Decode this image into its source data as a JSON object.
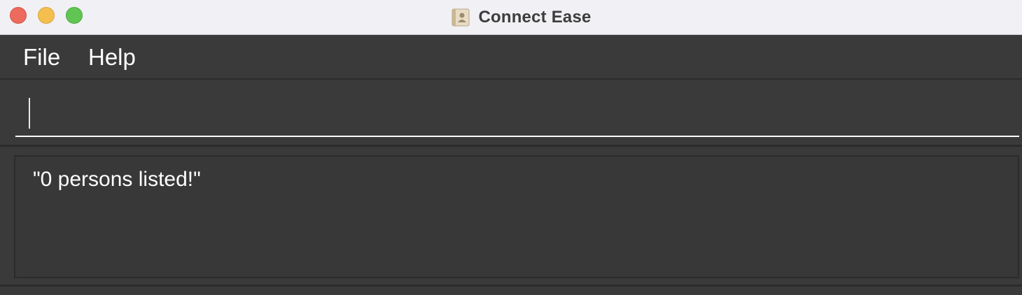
{
  "window": {
    "title": "Connect Ease",
    "controls": [
      "close",
      "minimize",
      "zoom"
    ]
  },
  "menu": {
    "items": [
      {
        "label": "File"
      },
      {
        "label": "Help"
      }
    ]
  },
  "command_box": {
    "value": "",
    "placeholder": ""
  },
  "result_display": {
    "text": "\"0 persons listed!\""
  },
  "colors": {
    "background": "#3a3a3a",
    "titlebar": "#f1f0f4",
    "close": "#ec6a5e",
    "minimize": "#f4bf4f",
    "zoom": "#61c554",
    "text": "#ffffff"
  },
  "icons": {
    "app_icon": "contact-book-icon"
  }
}
